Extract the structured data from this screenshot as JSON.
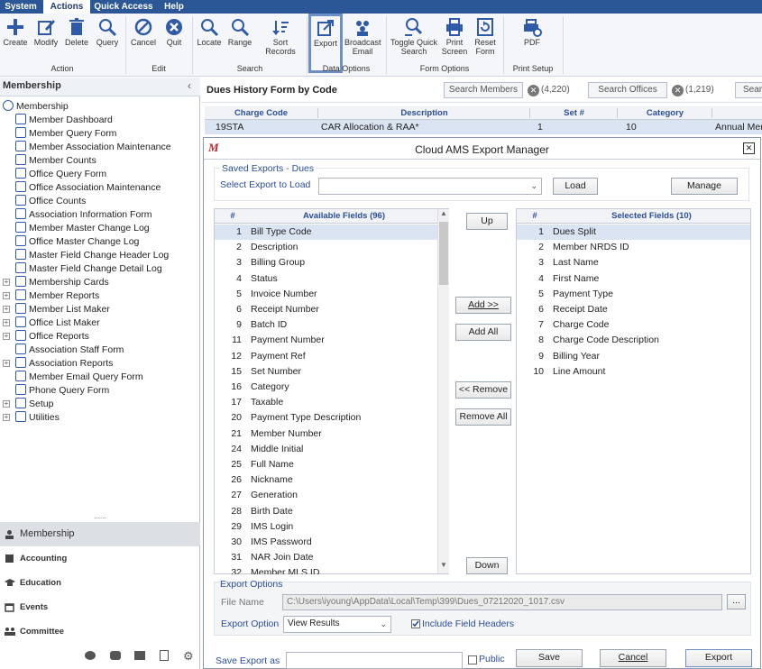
{
  "menu": [
    "System",
    "Actions",
    "Quick Access",
    "Help"
  ],
  "ribbon": {
    "buttons": {
      "create": "Create",
      "modify": "Modify",
      "delete": "Delete",
      "query": "Query",
      "cancel": "Cancel",
      "quit": "Quit",
      "locate": "Locate",
      "range": "Range",
      "sort": "Sort Records",
      "export": "Export",
      "broadcast1": "Broadcast",
      "broadcast2": "Email",
      "toggle1": "Toggle Quick",
      "toggle2": "Search",
      "print1": "Print",
      "print2": "Screen",
      "reset1": "Reset",
      "reset2": "Form",
      "pdf": "PDF"
    },
    "groups": {
      "action": "Action",
      "edit": "Edit",
      "search": "Search",
      "data": "Data Options",
      "form": "Form Options",
      "print": "Print Setup"
    }
  },
  "sidebar": {
    "title": "Membership",
    "items": [
      "Membership",
      "Member Dashboard",
      "Member Query Form",
      "Member Association Maintenance",
      "Member Counts",
      "Office Query Form",
      "Office Association Maintenance",
      "Office Counts",
      "Association Information Form",
      "Member Master Change Log",
      "Office Master Change Log",
      "Master Field Change Header Log",
      "Master Field Change Detail Log",
      "Membership Cards",
      "Member Reports",
      "Member List Maker",
      "Office List Maker",
      "Office Reports",
      "Association Staff Form",
      "Association Reports",
      "Member Email Query Form",
      "Phone Query Form",
      "Setup",
      "Utilities"
    ],
    "splitter": "......",
    "nav": [
      "Membership",
      "Accounting",
      "Education",
      "Events",
      "Committee"
    ]
  },
  "form": {
    "title": "Dues History Form by Code",
    "search_members": "Search Members",
    "members_count": "(4,220)",
    "search_offices": "Search Offices",
    "offices_count": "(1,219)",
    "search_more": "Sear",
    "columns": [
      "Charge Code",
      "Description",
      "Set #",
      "Category"
    ],
    "row": [
      "19STA",
      "CAR Allocation & RAA*",
      "1",
      "10",
      "Annual Mer"
    ]
  },
  "dialog": {
    "logo": "M",
    "title": "Cloud AMS Export Manager",
    "close": "✕",
    "saved_exports": "Saved Exports - Dues",
    "select_label": "Select Export to Load",
    "load": "Load",
    "manage": "Manage",
    "available_head": "Available Fields (96)",
    "selected_head": "Selected Fields (10)",
    "hash": "#",
    "available": [
      [
        "1",
        "Bill Type Code"
      ],
      [
        "2",
        "Description"
      ],
      [
        "3",
        "Billing Group"
      ],
      [
        "4",
        "Status"
      ],
      [
        "5",
        "Invoice Number"
      ],
      [
        "6",
        "Receipt Number"
      ],
      [
        "9",
        "Batch ID"
      ],
      [
        "11",
        "Payment Number"
      ],
      [
        "12",
        "Payment Ref"
      ],
      [
        "15",
        "Set Number"
      ],
      [
        "16",
        "Category"
      ],
      [
        "17",
        "Taxable"
      ],
      [
        "20",
        "Payment Type Description"
      ],
      [
        "21",
        "Member Number"
      ],
      [
        "24",
        "Middle Initial"
      ],
      [
        "25",
        "Full Name"
      ],
      [
        "26",
        "Nickname"
      ],
      [
        "27",
        "Generation"
      ],
      [
        "28",
        "Birth Date"
      ],
      [
        "29",
        "IMS Login"
      ],
      [
        "30",
        "IMS Password"
      ],
      [
        "31",
        "NAR Join Date"
      ],
      [
        "32",
        "Member MLS ID"
      ]
    ],
    "selected": [
      [
        "1",
        "Dues Split"
      ],
      [
        "2",
        "Member NRDS ID"
      ],
      [
        "3",
        "Last Name"
      ],
      [
        "4",
        "First Name"
      ],
      [
        "5",
        "Payment Type"
      ],
      [
        "6",
        "Receipt Date"
      ],
      [
        "7",
        "Charge Code"
      ],
      [
        "8",
        "Charge Code Description"
      ],
      [
        "9",
        "Billing Year"
      ],
      [
        "10",
        "Line Amount"
      ]
    ],
    "up": "Up",
    "down": "Down",
    "add": "Add >>",
    "add_all": "Add All",
    "remove": "<< Remove",
    "remove_all": "Remove All",
    "export_options": "Export Options",
    "file_name_label": "File Name",
    "file_name": "C:\\Users\\iyoung\\AppData\\Local\\Temp\\399\\Dues_07212020_1017.csv",
    "browse": "...",
    "export_option_label": "Export Option",
    "export_option": "View Results",
    "include_headers": "Include Field Headers",
    "save_as_label": "Save Export as",
    "public": "Public",
    "save": "Save",
    "cancel": "Cancel",
    "export": "Export"
  }
}
